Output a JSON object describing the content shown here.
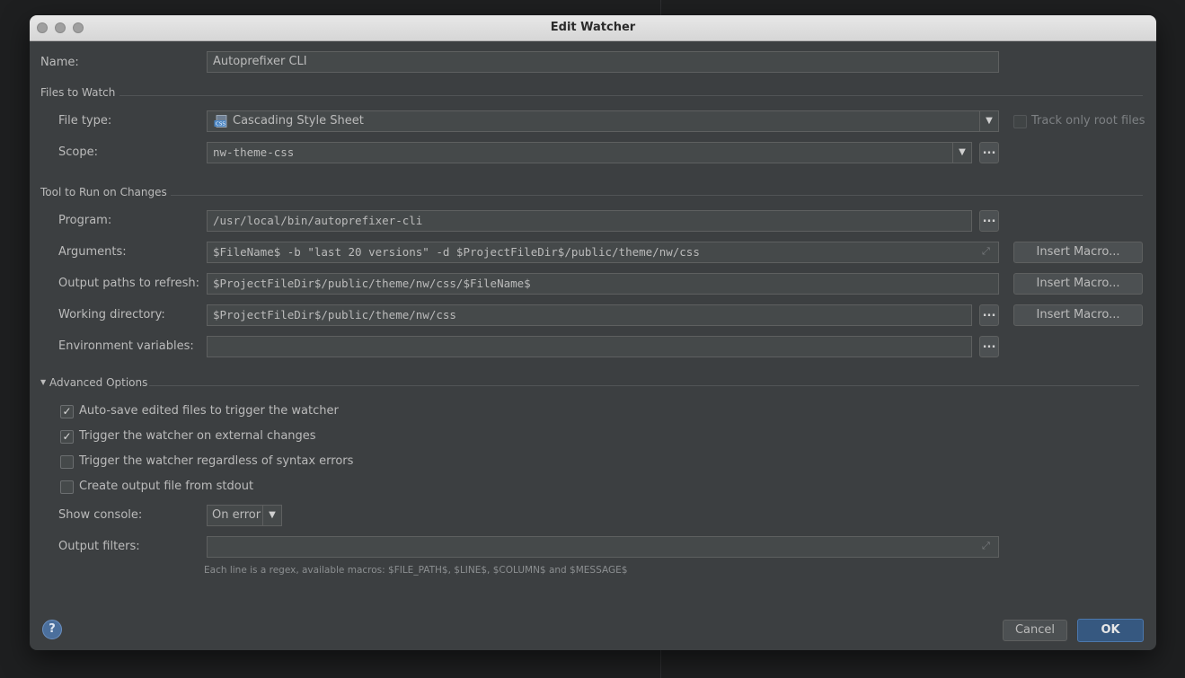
{
  "window": {
    "title": "Edit Watcher"
  },
  "name": {
    "label": "Name:",
    "value": "Autoprefixer CLI"
  },
  "files_to_watch": {
    "section_title": "Files to Watch",
    "file_type": {
      "label": "File type:",
      "value": "Cascading Style Sheet",
      "icon": "css-file-icon"
    },
    "track_only_root_files": {
      "label": "Track only root files",
      "checked": false,
      "enabled": false
    },
    "scope": {
      "label": "Scope:",
      "value": "nw-theme-css",
      "browse_label": "..."
    }
  },
  "tool": {
    "section_title": "Tool to Run on Changes",
    "program": {
      "label": "Program:",
      "value": "/usr/local/bin/autoprefixer-cli",
      "browse_label": "..."
    },
    "arguments": {
      "label": "Arguments:",
      "value": "$FileName$ -b \"last 20 versions\" -d $ProjectFileDir$/public/theme/nw/css",
      "macro_label": "Insert Macro..."
    },
    "output_paths": {
      "label": "Output paths to refresh:",
      "value": "$ProjectFileDir$/public/theme/nw/css/$FileName$",
      "macro_label": "Insert Macro..."
    },
    "working_directory": {
      "label": "Working directory:",
      "value": "$ProjectFileDir$/public/theme/nw/css",
      "browse_label": "...",
      "macro_label": "Insert Macro..."
    },
    "environment_variables": {
      "label": "Environment variables:",
      "value": "",
      "browse_label": "..."
    }
  },
  "advanced": {
    "section_title": "Advanced Options",
    "expanded": true,
    "options": [
      {
        "label": "Auto-save edited files to trigger the watcher",
        "checked": true
      },
      {
        "label": "Trigger the watcher on external changes",
        "checked": true
      },
      {
        "label": "Trigger the watcher regardless of syntax errors",
        "checked": false
      },
      {
        "label": "Create output file from stdout",
        "checked": false
      }
    ],
    "show_console": {
      "label": "Show console:",
      "value": "On error"
    },
    "output_filters": {
      "label": "Output filters:",
      "value": "",
      "hint": "Each line is a regex, available macros: $FILE_PATH$, $LINE$, $COLUMN$ and $MESSAGE$"
    }
  },
  "footer": {
    "help_label": "?",
    "cancel_label": "Cancel",
    "ok_label": "OK"
  },
  "colors": {
    "dialog_bg": "#3c3f41",
    "field_bg": "#45494a",
    "accent_ok": "#365880",
    "text": "#bbbbbb"
  }
}
